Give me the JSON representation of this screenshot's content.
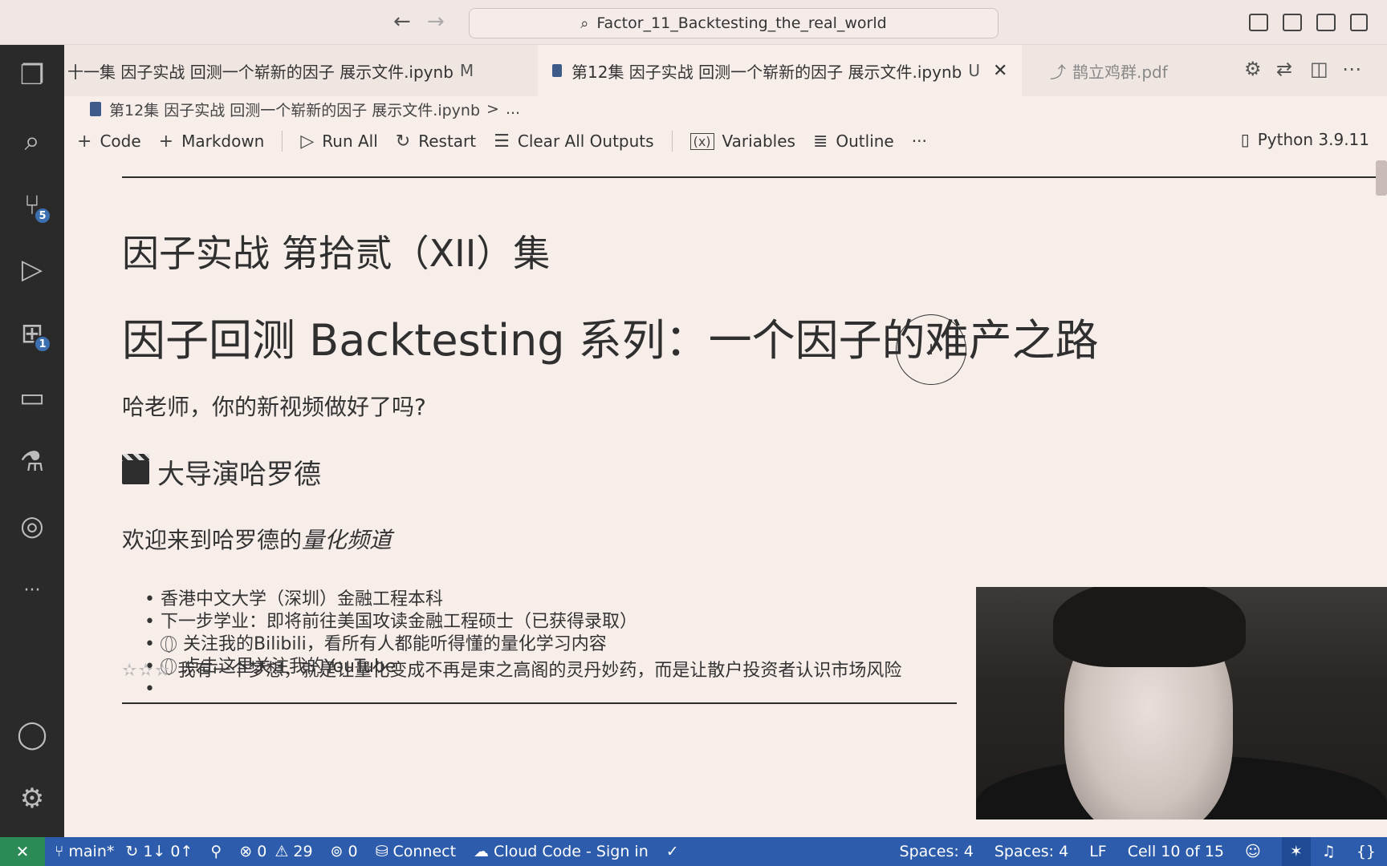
{
  "titlebar": {
    "search_text": "Factor_11_Backtesting_the_real_world"
  },
  "activity": {
    "source_control_badge": "5",
    "extensions_badge": "1",
    "more": "···"
  },
  "tabs": [
    {
      "label": "十一集 因子实战 回测一个崭新的因子 展示文件.ipynb",
      "status": "M"
    },
    {
      "label": "第12集 因子实战 回测一个崭新的因子 展示文件.ipynb",
      "status": "U"
    },
    {
      "label": "鹊立鸡群.pdf"
    }
  ],
  "breadcrumb": {
    "file": "第12集 因子实战 回测一个崭新的因子 展示文件.ipynb",
    "sep": ">",
    "more": "..."
  },
  "toolbar": {
    "code": "Code",
    "markdown": "Markdown",
    "run_all": "Run All",
    "restart": "Restart",
    "clear_outputs": "Clear All Outputs",
    "variables": "Variables",
    "outline": "Outline",
    "more": "···",
    "kernel": "Python 3.9.11"
  },
  "notebook": {
    "heading1": "因子实战 第拾贰（XII）集",
    "heading2": "因子回测 Backtesting 系列：一个因子的难产之路",
    "question": "哈老师，你的新视频做好了吗?",
    "director": "大导演哈罗德",
    "welcome_prefix": "欢迎来到哈罗德的",
    "welcome_em": "量化频道",
    "bullets": [
      "香港中文大学（深圳）金融工程本科",
      "下一步学业：即将前往美国攻读金融工程硕士（已获得录取）",
      "关注我的Bilibili，看所有人都能听得懂的量化学习内容",
      "点击这里关注我的YouTube",
      ""
    ],
    "dream": "我有一个梦想，就是让量化变成不再是束之高阁的灵丹妙药，而是让散户投资者认识市场风险"
  },
  "cursor": "I",
  "statusbar": {
    "branch": "main*",
    "sync": "1↓ 0↑",
    "errors": "0",
    "warnings": "29",
    "ports": "0",
    "connect": "Connect",
    "cloud_code": "Cloud Code - Sign in",
    "spaces1": "Spaces: 4",
    "spaces2": "Spaces: 4",
    "eol": "LF",
    "cell": "Cell 10 of 15"
  },
  "colors": {
    "statusbar": "#2c5cab",
    "remote": "#2b8b57",
    "activitybar": "#2b2a2a",
    "editor_bg": "#f7eeea"
  }
}
